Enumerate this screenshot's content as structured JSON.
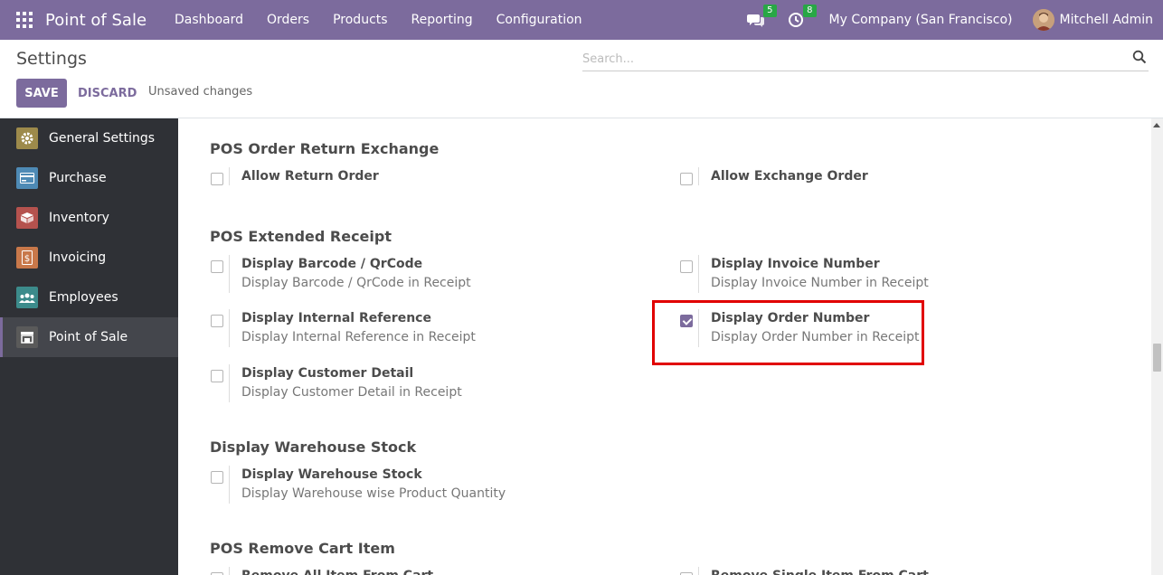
{
  "navbar": {
    "app_name": "Point of Sale",
    "menu": [
      "Dashboard",
      "Orders",
      "Products",
      "Reporting",
      "Configuration"
    ],
    "messages_count": "5",
    "activities_count": "8",
    "company": "My Company (San Francisco)",
    "user": "Mitchell Admin"
  },
  "control": {
    "title": "Settings",
    "save_label": "SAVE",
    "discard_label": "DISCARD",
    "status": "Unsaved changes",
    "search_placeholder": "Search..."
  },
  "sidebar": {
    "items": [
      {
        "label": "General Settings",
        "icon": "gear-icon",
        "color": "#9d8a4b"
      },
      {
        "label": "Purchase",
        "icon": "credit-card-icon",
        "color": "#4e8ab5"
      },
      {
        "label": "Inventory",
        "icon": "box-icon",
        "color": "#b5524e"
      },
      {
        "label": "Invoicing",
        "icon": "invoice-icon",
        "color": "#c8784a"
      },
      {
        "label": "Employees",
        "icon": "users-icon",
        "color": "#3c8b8b"
      },
      {
        "label": "Point of Sale",
        "icon": "store-icon",
        "color": "#5a5a5a",
        "active": true
      }
    ]
  },
  "sections": [
    {
      "title": "POS Order Return Exchange",
      "settings": [
        {
          "label": "Allow Return Order",
          "desc": "",
          "checked": false
        },
        {
          "label": "Allow Exchange Order",
          "desc": "",
          "checked": false
        }
      ]
    },
    {
      "title": "POS Extended Receipt",
      "settings": [
        {
          "label": "Display Barcode / QrCode",
          "desc": "Display Barcode / QrCode in Receipt",
          "checked": false
        },
        {
          "label": "Display Invoice Number",
          "desc": "Display Invoice Number in Receipt",
          "checked": false
        },
        {
          "label": "Display Internal Reference",
          "desc": "Display Internal Reference in Receipt",
          "checked": false
        },
        {
          "label": "Display Order Number",
          "desc": "Display Order Number in Receipt",
          "checked": true
        },
        {
          "label": "Display Customer Detail",
          "desc": "Display Customer Detail in Receipt",
          "checked": false
        }
      ]
    },
    {
      "title": "Display Warehouse Stock",
      "settings": [
        {
          "label": "Display Warehouse Stock",
          "desc": "Display Warehouse wise Product Quantity",
          "checked": false
        }
      ]
    },
    {
      "title": "POS Remove Cart Item",
      "settings": [
        {
          "label": "Remove All Item From Cart",
          "desc": "",
          "checked": false
        },
        {
          "label": "Remove Single Item From Cart",
          "desc": "",
          "checked": false
        }
      ]
    }
  ],
  "colors": {
    "brand": "#7c6b9d",
    "highlight": "#e10000",
    "badge": "#28a745"
  }
}
